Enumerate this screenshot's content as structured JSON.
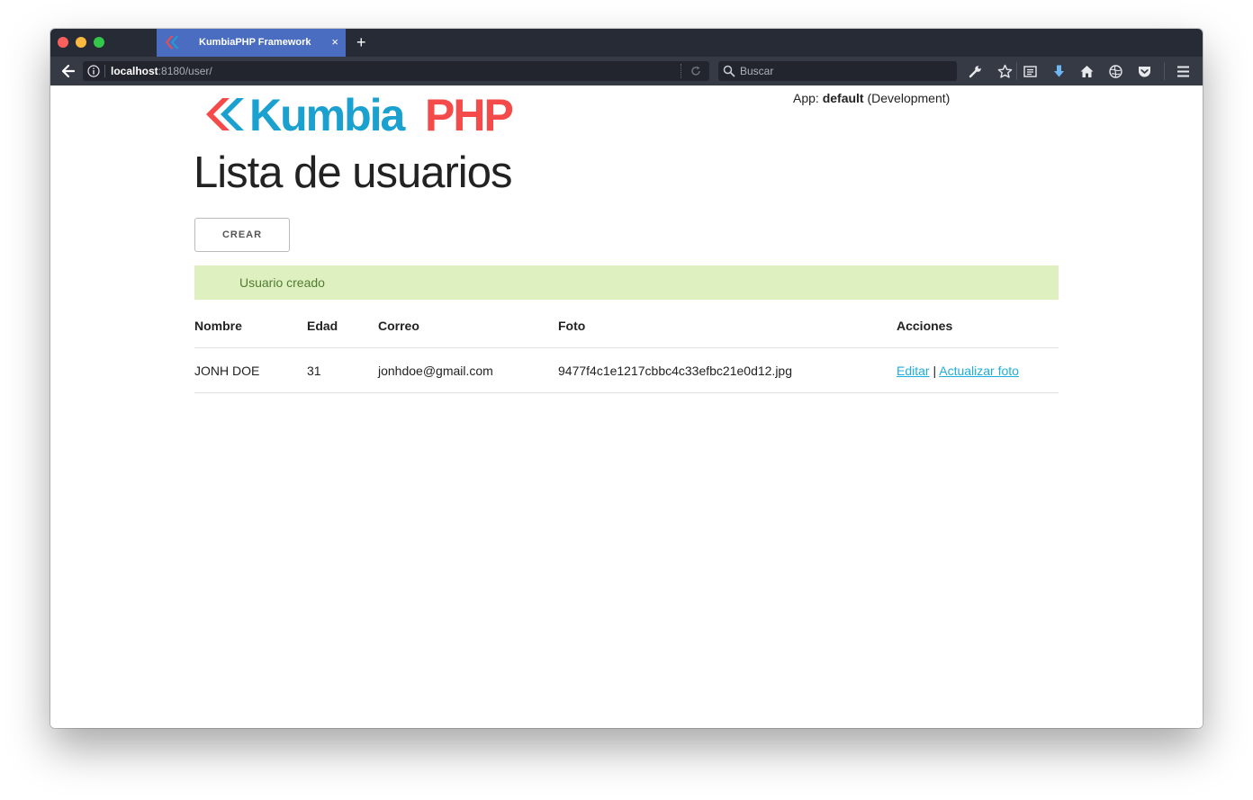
{
  "browser": {
    "tab": {
      "title": "KumbiaPHP Framework",
      "close_glyph": "×"
    },
    "new_tab_glyph": "+",
    "url": {
      "host": "localhost",
      "rest": ":8180/user/"
    },
    "search": {
      "placeholder": "Buscar"
    },
    "toolbar_icons": [
      "wrench-icon",
      "star-icon",
      "reading-list-icon",
      "download-icon",
      "home-icon",
      "globe-icon",
      "pocket-icon",
      "menu-icon"
    ]
  },
  "page": {
    "logo": {
      "part1": "Kumbia",
      "part2": "PHP"
    },
    "app_info": {
      "prefix": "App:",
      "name": "default",
      "env": "(Development)"
    },
    "title": "Lista de usuarios",
    "create_button": "CREAR",
    "flash_message": "Usuario creado",
    "table": {
      "headers": [
        "Nombre",
        "Edad",
        "Correo",
        "Foto",
        "Acciones"
      ],
      "rows": [
        {
          "nombre": "JONH DOE",
          "edad": "31",
          "correo": "jonhdoe@gmail.com",
          "foto": "9477f4c1e1217cbbc4c33efbc21e0d12.jpg",
          "edit_label": "Editar",
          "separator": "|",
          "update_photo_label": "Actualizar foto"
        }
      ]
    }
  },
  "colors": {
    "tab_active": "#4a6dc1",
    "logo_blue": "#1aa1d0",
    "logo_red": "#f44a4a",
    "flash_bg": "#dff0c0",
    "flash_text": "#4f7d31",
    "link": "#1eaedb"
  }
}
